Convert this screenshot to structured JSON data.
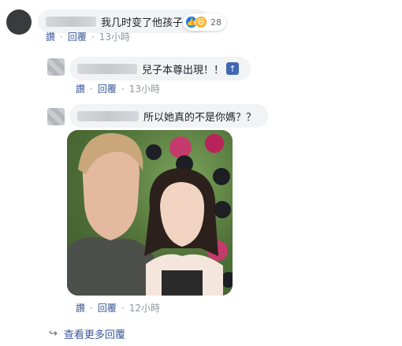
{
  "comments": [
    {
      "text": "我几时变了他孩子",
      "reactions": {
        "icons": [
          "like-icon",
          "haha-icon"
        ],
        "count": "28"
      },
      "actions": {
        "like": "讚",
        "reply": "回覆",
        "time": "13小時"
      }
    },
    {
      "text": "兒子本尊出現！！",
      "badge_icon": "up-arrow-icon",
      "actions": {
        "like": "讚",
        "reply": "回覆",
        "time": "13小時"
      }
    },
    {
      "text": "所以她真的不是你媽？？",
      "has_photo": true,
      "actions": {
        "like": "讚",
        "reply": "回覆",
        "time": "12小時"
      }
    }
  ],
  "view_more": {
    "label": "查看更多回覆",
    "icon": "reply-arrow-icon"
  },
  "colors": {
    "link": "#385898",
    "meta": "#90949c",
    "bubble": "#f2f3f5",
    "like": "#1877f2"
  }
}
